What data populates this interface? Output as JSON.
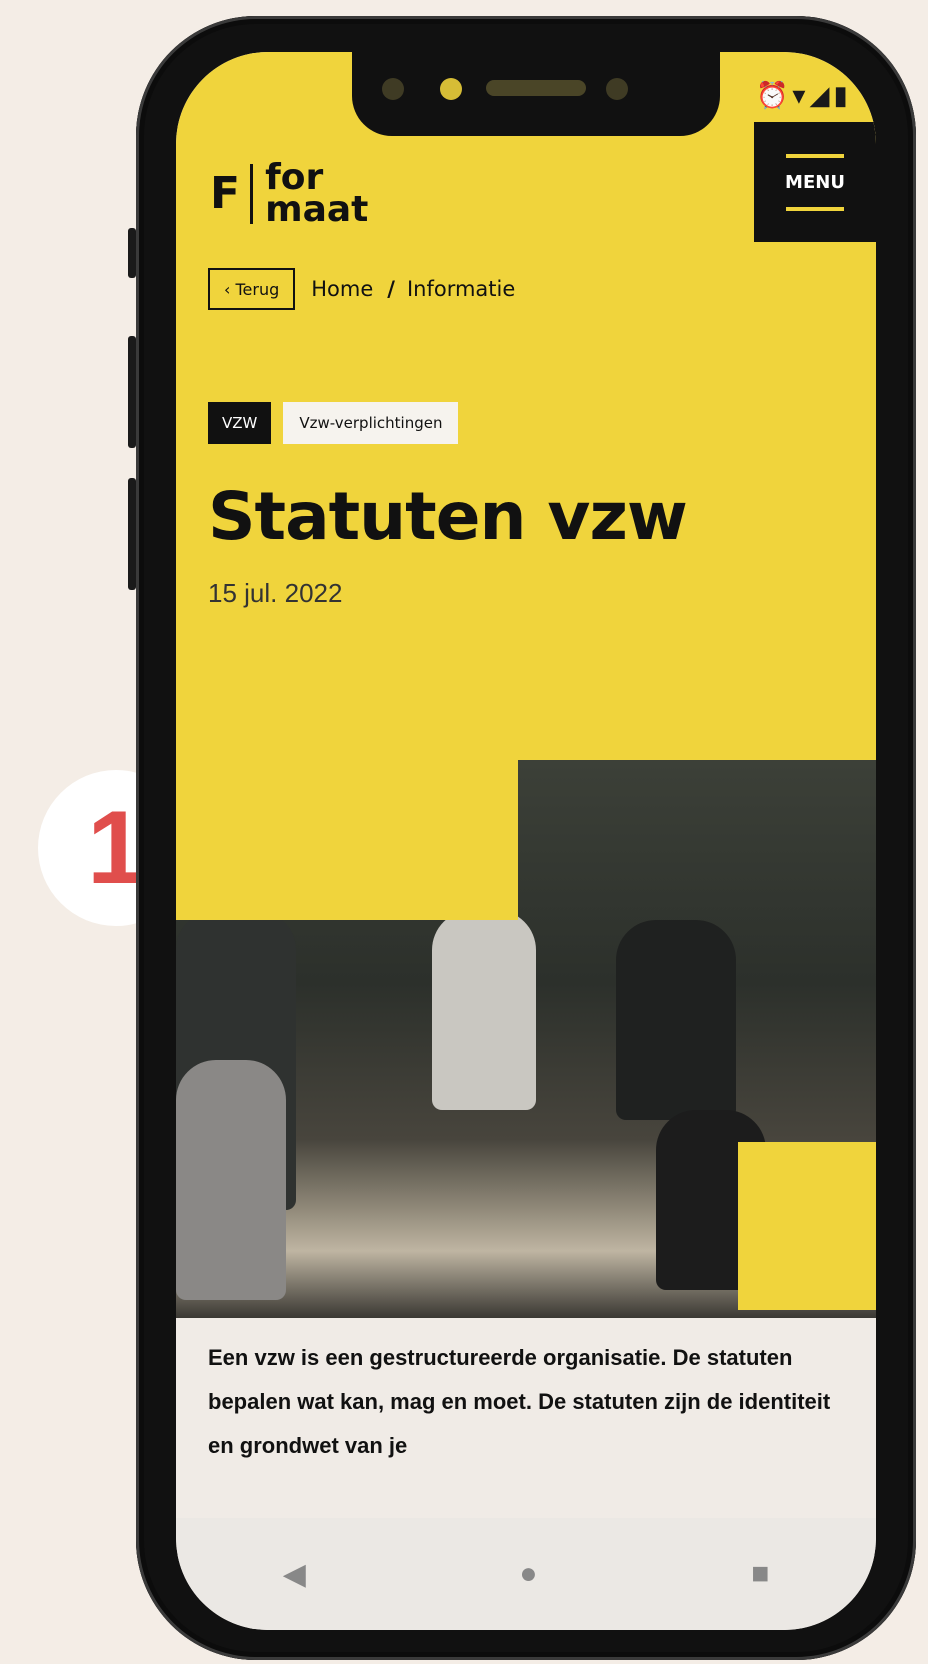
{
  "step_badge": {
    "number": "1"
  },
  "status_bar": {
    "icons": [
      "alarm-icon",
      "wifi-icon",
      "signal-icon",
      "battery-icon"
    ]
  },
  "header": {
    "logo_mark": "F",
    "logo_text_line1": "for",
    "logo_text_line2": "maat",
    "menu_label": "MENU"
  },
  "breadcrumb": {
    "back_label": "‹ Terug",
    "items": [
      "Home",
      "Informatie"
    ],
    "separator": "/"
  },
  "tags": [
    "VZW",
    "Vzw-verplichtingen"
  ],
  "article": {
    "title": "Statuten vzw",
    "date": "15 jul. 2022",
    "intro": "Een vzw is een gestructureerde organisatie. De statuten bepalen wat kan, mag en moet. De statuten zijn de identiteit en grondwet van je"
  },
  "nav_bar": {
    "back": "◀",
    "home": "●",
    "recents": "■"
  },
  "colors": {
    "brand_yellow": "#f0d43c",
    "accent_red": "#e04e4c",
    "ink": "#111111"
  }
}
